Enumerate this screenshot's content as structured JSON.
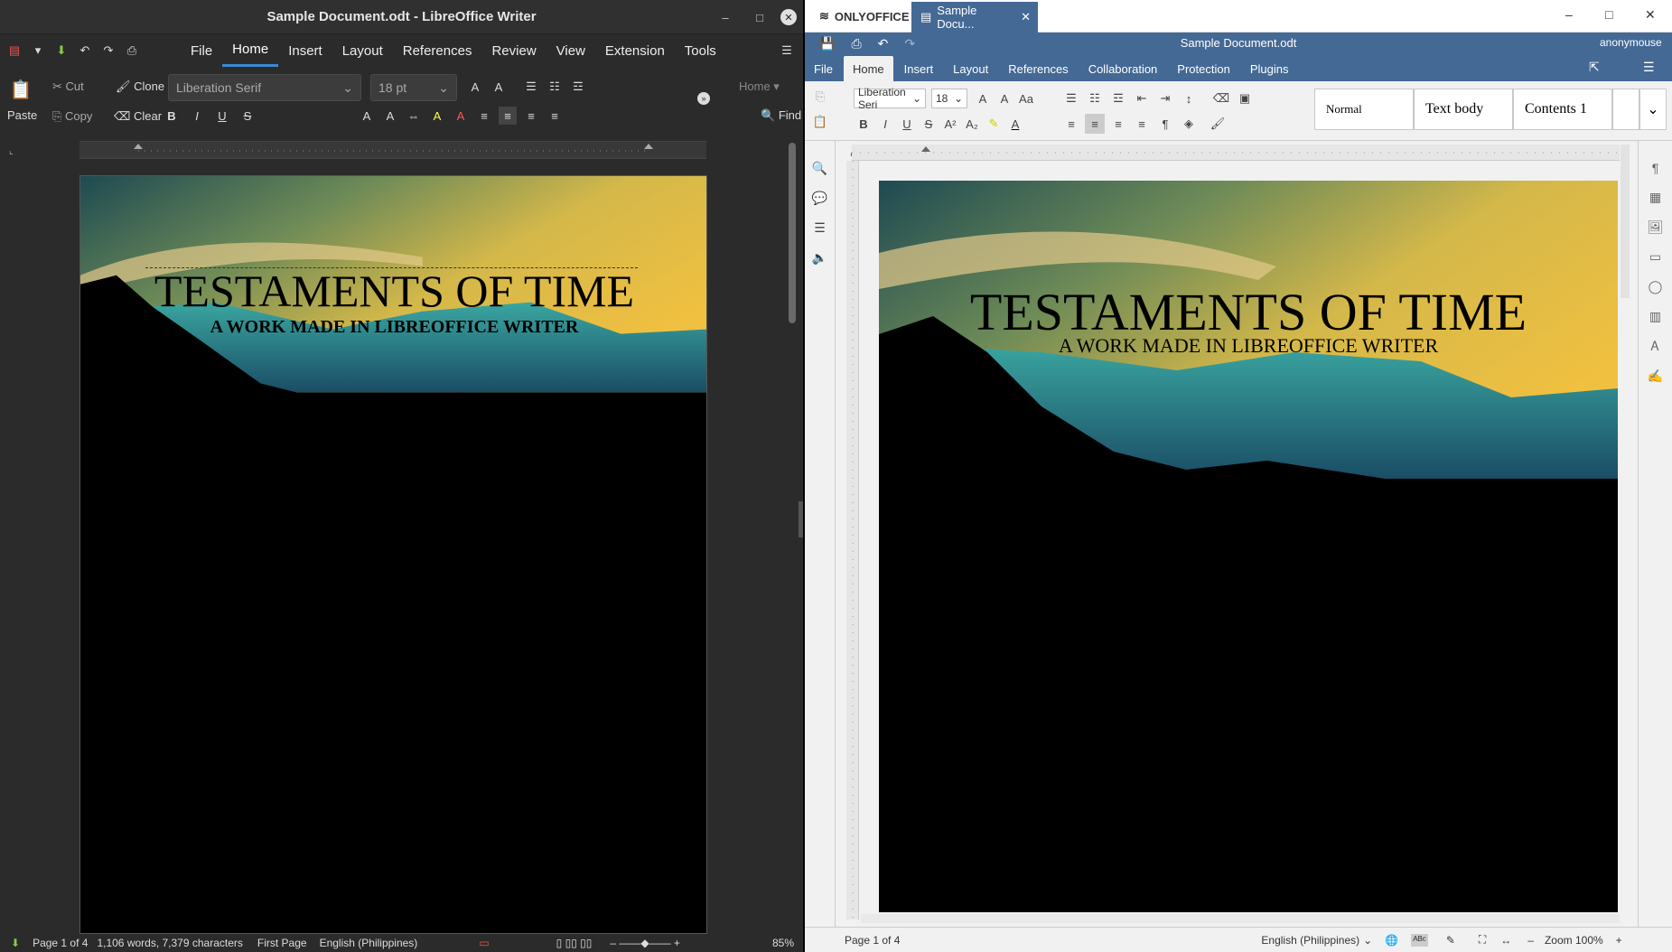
{
  "libreoffice": {
    "window_title": "Sample Document.odt - LibreOffice Writer",
    "menu_tabs": [
      "File",
      "Home",
      "Insert",
      "Layout",
      "References",
      "Review",
      "View",
      "Extension",
      "Tools"
    ],
    "active_tab": "Home",
    "paste_label": "Paste",
    "cut_label": "Cut",
    "copy_label": "Copy",
    "clone_label": "Clone",
    "clear_label": "Clear",
    "font_name": "Liberation Serif",
    "font_size": "18 pt",
    "home_dropdown": "Home",
    "find_label": "Find",
    "doc_title": "TESTAMENTS OF TIME",
    "doc_subtitle": "A WORK MADE IN LIBREOFFICE WRITER",
    "status": {
      "page": "Page 1 of 4",
      "words": "1,106 words, 7,379 characters",
      "page_style": "First Page",
      "language": "English (Philippines)",
      "zoom": "85%"
    }
  },
  "onlyoffice": {
    "brand": "ONLYOFFICE",
    "tab_label": "Sample Docu...",
    "doc_name": "Sample Document.odt",
    "user": "anonymouse",
    "menu_tabs": [
      "File",
      "Home",
      "Insert",
      "Layout",
      "References",
      "Collaboration",
      "Protection",
      "Plugins"
    ],
    "active_tab": "Home",
    "font_name": "Liberation Seri",
    "font_size": "18",
    "styles": [
      "Normal",
      "Text body",
      "Contents 1"
    ],
    "doc_title": "TESTAMENTS OF TIME",
    "doc_subtitle": "A WORK MADE IN LIBREOFFICE WRITER",
    "status": {
      "page": "Page 1 of 4",
      "language": "English (Philippines)",
      "zoom": "Zoom 100%"
    }
  }
}
